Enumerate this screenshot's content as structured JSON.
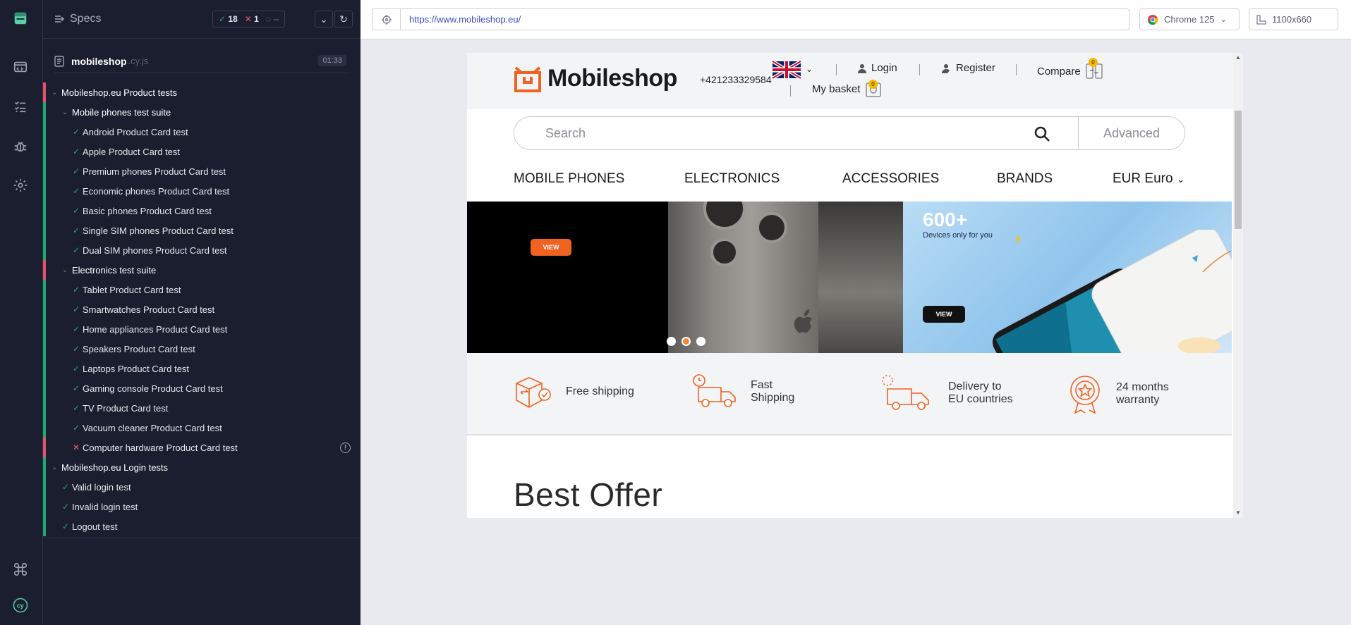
{
  "specs": {
    "title": "Specs",
    "stats": {
      "passed": "18",
      "failed": "1",
      "pending": "--"
    },
    "file": {
      "name": "mobileshop",
      "ext": ".cy.js",
      "duration": "01:33"
    },
    "tree": [
      {
        "kind": "group",
        "label": "Mobileshop.eu Product tests",
        "bar": "red",
        "indent": 0
      },
      {
        "kind": "group",
        "label": "Mobile phones test suite",
        "bar": "green",
        "indent": 1
      },
      {
        "kind": "test",
        "label": "Android Product Card test",
        "status": "pass",
        "bar": "green",
        "indent": 2
      },
      {
        "kind": "test",
        "label": "Apple Product Card test",
        "status": "pass",
        "bar": "green",
        "indent": 2
      },
      {
        "kind": "test",
        "label": "Premium phones Product Card test",
        "status": "pass",
        "bar": "green",
        "indent": 2
      },
      {
        "kind": "test",
        "label": "Economic phones Product Card test",
        "status": "pass",
        "bar": "green",
        "indent": 2
      },
      {
        "kind": "test",
        "label": "Basic phones Product Card test",
        "status": "pass",
        "bar": "green",
        "indent": 2
      },
      {
        "kind": "test",
        "label": "Single SIM phones Product Card test",
        "status": "pass",
        "bar": "green",
        "indent": 2
      },
      {
        "kind": "test",
        "label": "Dual SIM phones Product Card test",
        "status": "pass",
        "bar": "green",
        "indent": 2
      },
      {
        "kind": "group",
        "label": "Electronics test suite",
        "bar": "red",
        "indent": 1
      },
      {
        "kind": "test",
        "label": "Tablet Product Card test",
        "status": "pass",
        "bar": "green",
        "indent": 2
      },
      {
        "kind": "test",
        "label": "Smartwatches Product Card test",
        "status": "pass",
        "bar": "green",
        "indent": 2
      },
      {
        "kind": "test",
        "label": "Home appliances Product Card test",
        "status": "pass",
        "bar": "green",
        "indent": 2
      },
      {
        "kind": "test",
        "label": "Speakers Product Card test",
        "status": "pass",
        "bar": "green",
        "indent": 2
      },
      {
        "kind": "test",
        "label": "Laptops Product Card test",
        "status": "pass",
        "bar": "green",
        "indent": 2
      },
      {
        "kind": "test",
        "label": "Gaming console Product Card test",
        "status": "pass",
        "bar": "green",
        "indent": 2
      },
      {
        "kind": "test",
        "label": "TV Product Card test",
        "status": "pass",
        "bar": "green",
        "indent": 2
      },
      {
        "kind": "test",
        "label": "Vacuum cleaner Product Card test",
        "status": "pass",
        "bar": "green",
        "indent": 2
      },
      {
        "kind": "test",
        "label": "Computer hardware Product Card test",
        "status": "fail",
        "bar": "red",
        "indent": 2,
        "warn": true
      },
      {
        "kind": "group",
        "label": "Mobileshop.eu Login tests",
        "bar": "green",
        "indent": 0
      },
      {
        "kind": "test",
        "label": "Valid login test",
        "status": "pass",
        "bar": "green",
        "indent": 1
      },
      {
        "kind": "test",
        "label": "Invalid login test",
        "status": "pass",
        "bar": "green",
        "indent": 1
      },
      {
        "kind": "test",
        "label": "Logout test",
        "status": "pass",
        "bar": "green",
        "indent": 1
      }
    ]
  },
  "toolbar": {
    "url": "https://www.mobileshop.eu/",
    "browser": "Chrome 125",
    "viewport": "1100x660"
  },
  "site": {
    "logo": "Mobileshop",
    "phone": "+421233329584",
    "login": "Login",
    "register": "Register",
    "compare": "Compare",
    "compare_count": "0",
    "basket": "My basket",
    "basket_count": "0",
    "search_placeholder": "Search",
    "advanced": "Advanced",
    "menu": [
      "MOBILE PHONES",
      "ELECTRONICS",
      "ACCESSORIES",
      "BRANDS",
      "EUR Euro"
    ],
    "banner_left_button": "VIEW",
    "banner_right_big": "600+",
    "banner_right_text": "Devices only for you",
    "banner_right_button": "VIEW",
    "features": [
      {
        "line1": "Free shipping",
        "line2": ""
      },
      {
        "line1": "Fast",
        "line2": "Shipping"
      },
      {
        "line1": "Delivery to",
        "line2": "EU countries"
      },
      {
        "line1": "24 months",
        "line2": "warranty"
      }
    ],
    "best_offer": "Best Offer"
  },
  "colors": {
    "accent": "#f0621f",
    "pass": "#1fa971",
    "fail": "#f15b6c",
    "panel": "#1b1e2e"
  }
}
